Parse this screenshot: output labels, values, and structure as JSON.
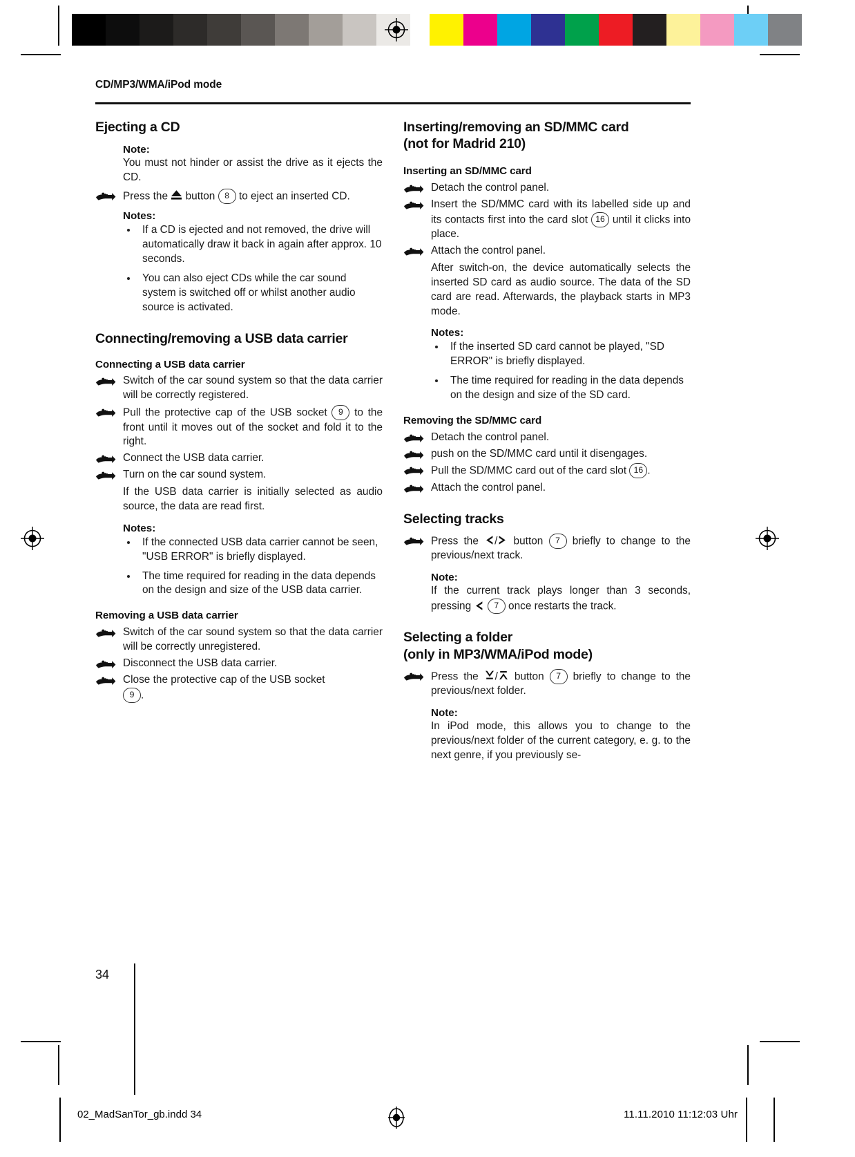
{
  "document": {
    "running_head": "CD/MP3/WMA/iPod mode",
    "page_number": "34"
  },
  "footer": {
    "file_slug": "02_MadSanTor_gb.indd   34",
    "timestamp": "11.11.2010   11:12:03 Uhr",
    "registration_icon": "registration-target-icon"
  },
  "prepress": {
    "gray_bar": [
      "#000000",
      "#0d0d0d",
      "#1c1b1a",
      "#2d2b29",
      "#3f3c39",
      "#5a5653",
      "#7d7874",
      "#a39e99",
      "#c9c5c1",
      "#ebe9e6",
      "#ffffff"
    ],
    "chroma_bar": [
      "#fff200",
      "#ec008c",
      "#00a5e3",
      "#2e3192",
      "#00a14b",
      "#ed1c24",
      "#231f20",
      "#fdf29a",
      "#f49ac1",
      "#6dcff6",
      "#808285"
    ]
  },
  "left_column": {
    "s1": {
      "heading": "Ejecting a CD",
      "note_label": "Note:",
      "note_text": "You must not hinder or assist the drive as it ejects the CD.",
      "step_1_a": "Press the",
      "step_1_b": "button",
      "step_1_ref": "8",
      "step_1_c": "to eject an inserted CD.",
      "eject_glyph": "eject-button-icon",
      "notes_label": "Notes:",
      "bullet_1": "If a CD is ejected and not removed, the drive will automatically draw it back in again after approx. 10 seconds.",
      "bullet_2": "You can also eject CDs while the car sound system is switched off or whilst another audio source is activated."
    },
    "s2": {
      "heading": "Connecting/removing a USB data carrier",
      "sub_1": "Connecting a USB data carrier",
      "step_1": "Switch of the car sound system so that the data carrier will be correctly registered.",
      "step_2_a": "Pull the protective cap of the USB socket",
      "step_2_ref": "9",
      "step_2_b": "to the front until it moves out of the socket and fold it to the right.",
      "step_3": "Connect the USB data carrier.",
      "step_4": "Turn on the car sound system.",
      "para_1": "If the USB data carrier is initially selected as audio source, the data are read first.",
      "notes_label": "Notes:",
      "bullet_1": "If the connected USB data carrier cannot be seen, \"USB ERROR\" is briefly displayed.",
      "bullet_2": "The time required for reading in the data depends on the design and size of the USB data carrier.",
      "sub_2": "Removing a USB data carrier",
      "step_5": "Switch of the car sound system so that the data carrier will be correctly unregistered.",
      "step_6": "Disconnect the USB data carrier.",
      "step_7_a": "Close the protective cap of the USB socket",
      "step_7_ref": "9",
      "step_7_b": "."
    }
  },
  "right_column": {
    "s1": {
      "heading_line_1": "Inserting/removing an SD/MMC card",
      "heading_line_2": "(not for Madrid 210)",
      "sub_1": "Inserting an SD/MMC card",
      "step_1": "Detach the control panel.",
      "step_2_a": "Insert the SD/MMC card with its labelled side up and its contacts first into the card slot",
      "step_2_ref": "16",
      "step_2_b": "until it clicks into place.",
      "step_3": "Attach the control panel.",
      "para_1": "After switch-on, the device automatically selects the inserted SD card as audio source. The data of the SD card are read. Afterwards, the playback starts in MP3 mode.",
      "notes_label": "Notes:",
      "bullet_1": "If the inserted SD card cannot be played, \"SD ERROR\" is briefly displayed.",
      "bullet_2": "The time required for reading in the data depends on the design and size of the SD card.",
      "sub_2": "Removing the SD/MMC card",
      "step_4": "Detach the control panel.",
      "step_5": "push on the SD/MMC card until it disengages.",
      "step_6_a": "Pull the SD/MMC card out of the card slot",
      "step_6_ref": "16",
      "step_6_b": ".",
      "step_7": "Attach the control panel."
    },
    "s2": {
      "heading": "Selecting tracks",
      "step_1_a": "Press the",
      "step_1_b": "button",
      "step_1_ref": "7",
      "step_1_c": "briefly to change to the previous/next track.",
      "prev_glyph": "chevron-left-icon",
      "next_glyph": "chevron-right-icon",
      "separator": "/",
      "note_label": "Note:",
      "note_a": "If the current track plays longer than 3 seconds, pressing",
      "note_ref": "7",
      "note_b": "once restarts the track."
    },
    "s3": {
      "heading_line_1": "Selecting a folder",
      "heading_line_2": "(only in MP3/WMA/iPod mode)",
      "step_1_a": "Press the",
      "step_1_b": "button",
      "step_1_ref": "7",
      "step_1_c": "briefly to change to the previous/next folder.",
      "down_glyph": "arrow-down-bar-icon",
      "up_glyph": "arrow-up-bar-icon",
      "separator": "/",
      "note_label": "Note:",
      "note_text": "In iPod mode, this allows you to change to the previous/next folder of the current category, e. g. to the next genre, if you previously se-"
    }
  }
}
